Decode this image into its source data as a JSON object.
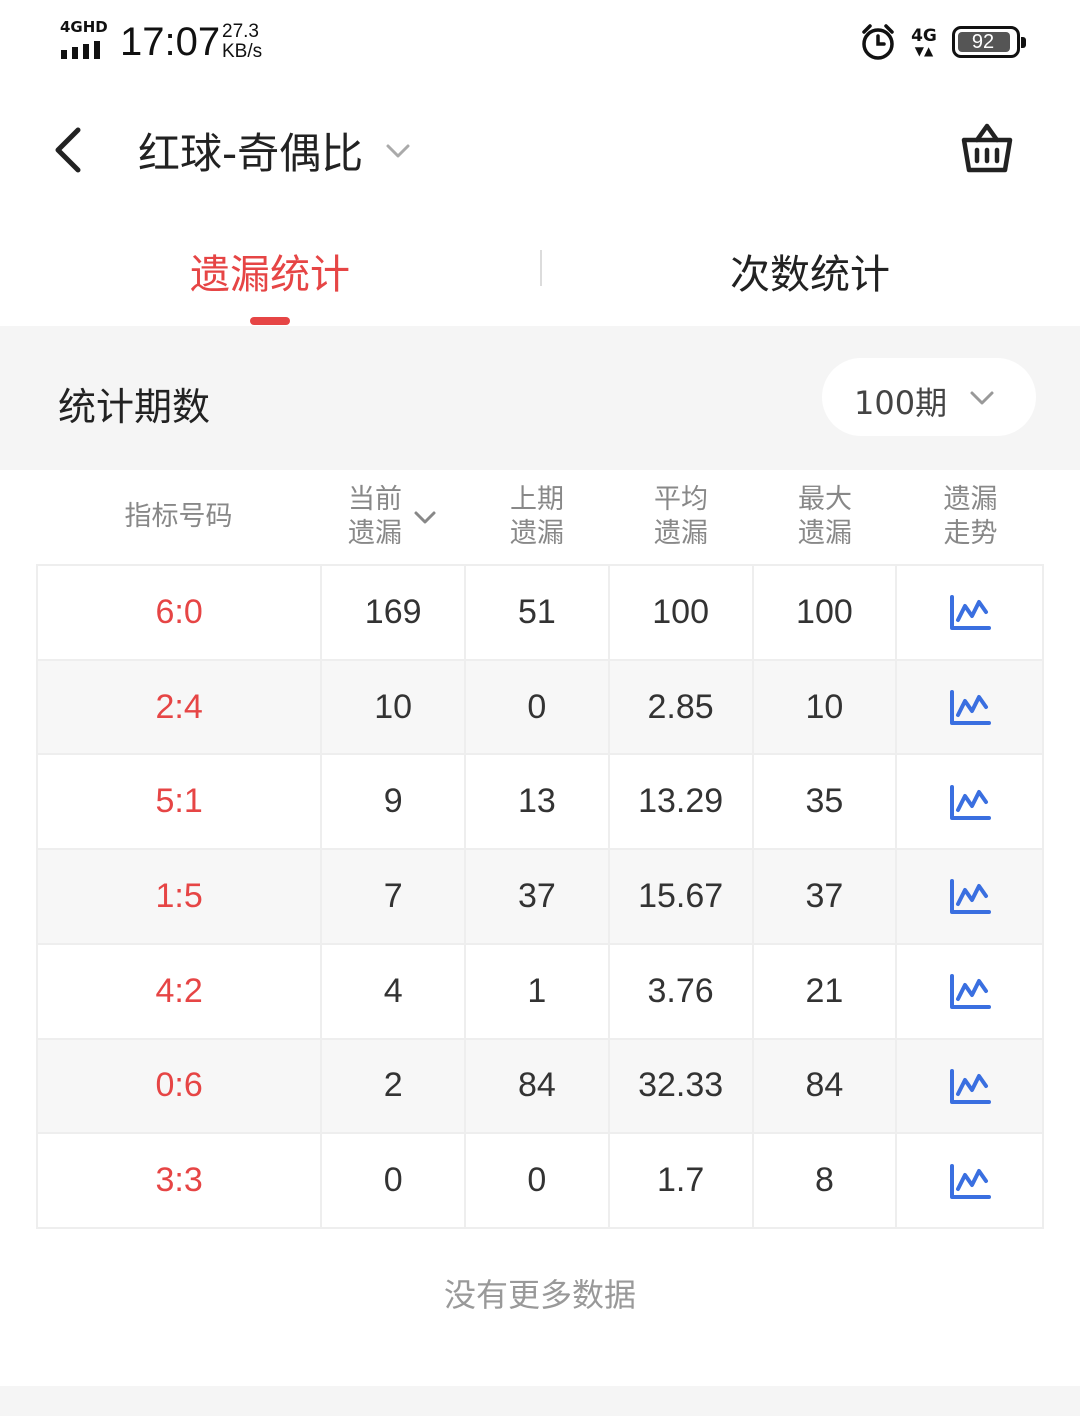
{
  "status_bar": {
    "network_tag": "4GHD",
    "time": "17:07",
    "speed_value": "27.3",
    "speed_unit": "KB/s",
    "net_type": "4G",
    "battery": "92"
  },
  "header": {
    "title": "红球-奇偶比",
    "icons": [
      "back-icon",
      "chevron-down-icon",
      "basket-icon"
    ]
  },
  "tabs": [
    {
      "label": "遗漏统计",
      "active": true
    },
    {
      "label": "次数统计",
      "active": false
    }
  ],
  "period": {
    "label": "统计期数",
    "selected": "100期"
  },
  "table": {
    "headers": [
      {
        "line1": "指标号码",
        "line2": ""
      },
      {
        "line1": "当前",
        "line2": "遗漏"
      },
      {
        "line1": "上期",
        "line2": "遗漏"
      },
      {
        "line1": "平均",
        "line2": "遗漏"
      },
      {
        "line1": "最大",
        "line2": "遗漏"
      },
      {
        "line1": "遗漏",
        "line2": "走势"
      }
    ],
    "rows": [
      {
        "code": "6:0",
        "current": "169",
        "previous": "51",
        "average": "100",
        "max": "100"
      },
      {
        "code": "2:4",
        "current": "10",
        "previous": "0",
        "average": "2.85",
        "max": "10"
      },
      {
        "code": "5:1",
        "current": "9",
        "previous": "13",
        "average": "13.29",
        "max": "35"
      },
      {
        "code": "1:5",
        "current": "7",
        "previous": "37",
        "average": "15.67",
        "max": "37"
      },
      {
        "code": "4:2",
        "current": "4",
        "previous": "1",
        "average": "3.76",
        "max": "21"
      },
      {
        "code": "0:6",
        "current": "2",
        "previous": "84",
        "average": "32.33",
        "max": "84"
      },
      {
        "code": "3:3",
        "current": "0",
        "previous": "0",
        "average": "1.7",
        "max": "8"
      }
    ],
    "footer": "没有更多数据"
  },
  "colors": {
    "accent": "#e64545",
    "trend_icon": "#3a6fe0",
    "header_text": "#888888"
  }
}
